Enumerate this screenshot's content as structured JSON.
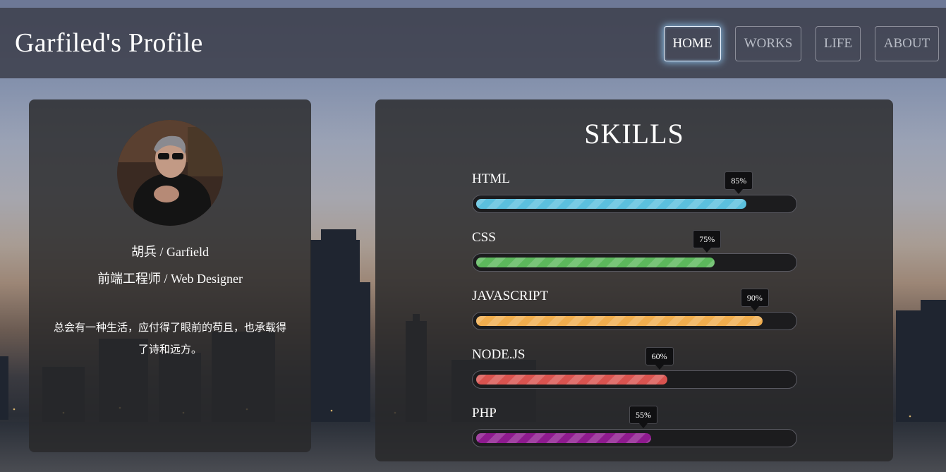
{
  "header": {
    "brand": "Garfiled's Profile",
    "nav": [
      {
        "label": "HOME",
        "active": true
      },
      {
        "label": "WORKS",
        "active": false
      },
      {
        "label": "LIFE",
        "active": false
      },
      {
        "label": "ABOUT",
        "active": false
      }
    ]
  },
  "profile": {
    "name": "胡兵 / Garfield",
    "title": "前端工程师 / Web Designer",
    "motto": "总会有一种生活，应付得了眼前的苟且，也承载得了诗和远方。"
  },
  "skills": {
    "heading": "SKILLS",
    "items": [
      {
        "label": "HTML",
        "percent": 85,
        "percent_text": "85%",
        "color": "#5bc0de"
      },
      {
        "label": "CSS",
        "percent": 75,
        "percent_text": "75%",
        "color": "#5cb85c"
      },
      {
        "label": "JAVASCRIPT",
        "percent": 90,
        "percent_text": "90%",
        "color": "#f0ad4e"
      },
      {
        "label": "NODE.JS",
        "percent": 60,
        "percent_text": "60%",
        "color": "#d9534f"
      },
      {
        "label": "PHP",
        "percent": 55,
        "percent_text": "55%",
        "color": "#8e1a8e"
      }
    ]
  }
}
